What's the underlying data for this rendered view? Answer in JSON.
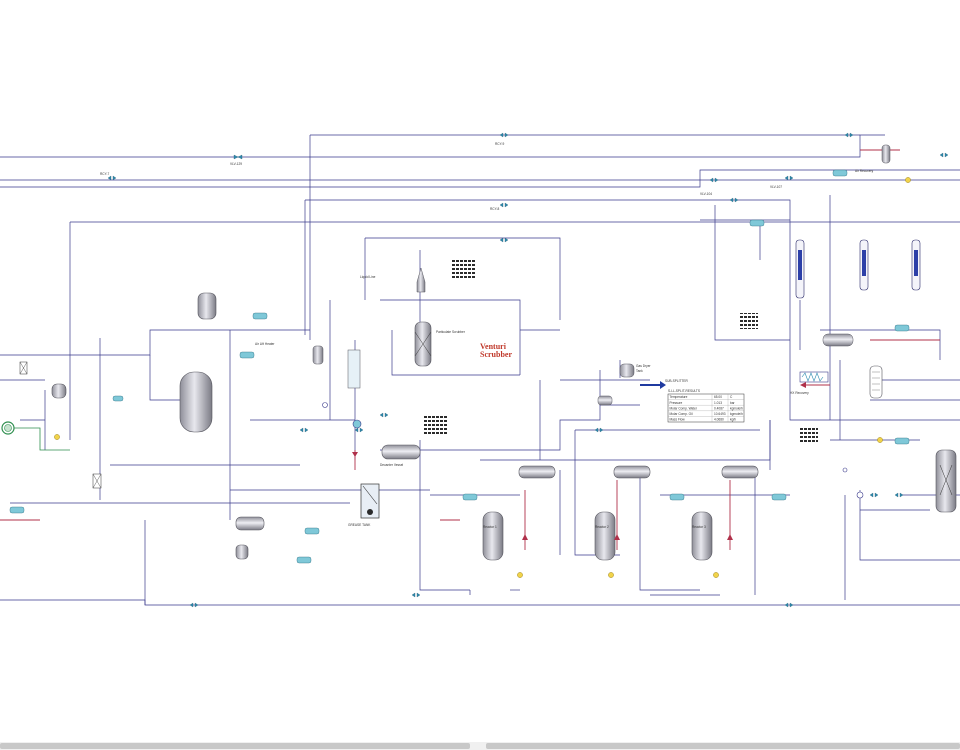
{
  "colors": {
    "stream": "#3a3a8c",
    "energy": "#b0304a",
    "utility": "#2f8f4f",
    "vessel_fill": "#d9d9de",
    "valve": "#2e8bb0",
    "accent_red": "#c0392b"
  },
  "labels": {
    "top_valves": [
      "VLV-129",
      "RCY-9",
      "RCY-7",
      "RCY-8",
      "VLV-104",
      "VLV-107"
    ],
    "air_recovery": "Air Recovery",
    "air_heater": "Air Lift Heater",
    "particulate": "Particulate Scrubber",
    "venturi_line1": "Venturi",
    "venturi_line2": "Scrubber",
    "hx_recovery": "HX Recovery",
    "stream_liq": "Liquid Line",
    "gas_dryer": "Gas Dryer",
    "tank_1": "Tank",
    "sub_header": "SUB-SPLITTER",
    "reactors": [
      "Reactor 1",
      "Reactor 2",
      "Reactor 3"
    ],
    "decanter": "Decanter Vessel",
    "grease": "GREASE TANK",
    "spreadsheet_title": "S-LL-SPLIT-RESULTS"
  },
  "spreadsheet": {
    "rows": [
      [
        "Temperature",
        "65.00",
        "C"
      ],
      [
        "Pressure",
        "1.013",
        "bar"
      ],
      [
        "Molar Comp. Water",
        "0.4087",
        "kgmole/h"
      ],
      [
        "Molar Comp. Oil",
        "10.6493",
        "kgmole/h"
      ],
      [
        "Mass Flow",
        "4.0680",
        "kg/h"
      ]
    ]
  },
  "scrollbar": {
    "label": "horizontal-scrollbar"
  }
}
